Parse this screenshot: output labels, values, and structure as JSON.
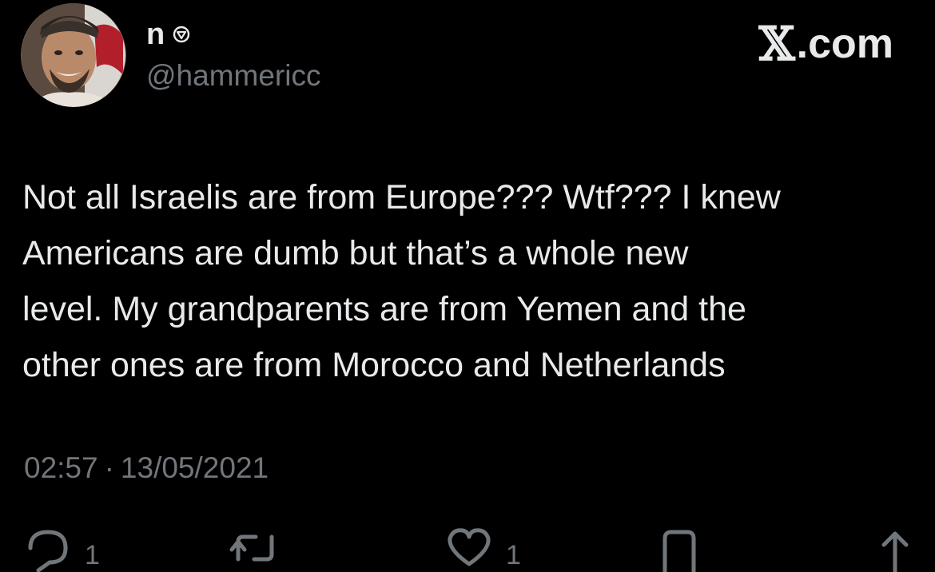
{
  "author": {
    "display_name": "n",
    "handle": "@hammericc",
    "badge_icon": "verified-hexagon-icon",
    "avatar_icon": "avatar-photo"
  },
  "brand": {
    "label": ".com",
    "logo_icon": "x-logo-icon"
  },
  "tweet": {
    "text": "Not all Israelis are from Europe??? Wtf??? I knew\nAmericans are dumb but that’s a whole new\nlevel. My grandparents are from Yemen and the\nother ones are from Morocco and Netherlands",
    "time": "02:57",
    "separator": "·",
    "date": "13/05/2021"
  },
  "actions": {
    "reply": {
      "icon": "reply-icon",
      "count": "1"
    },
    "retweet": {
      "icon": "retweet-icon",
      "count": ""
    },
    "like": {
      "icon": "heart-icon",
      "count": "1"
    },
    "bookmark": {
      "icon": "bookmark-icon",
      "count": ""
    },
    "share": {
      "icon": "share-icon",
      "count": ""
    }
  },
  "colors": {
    "background": "#000000",
    "primary_text": "#e7e9ea",
    "secondary_text": "#71767b"
  }
}
